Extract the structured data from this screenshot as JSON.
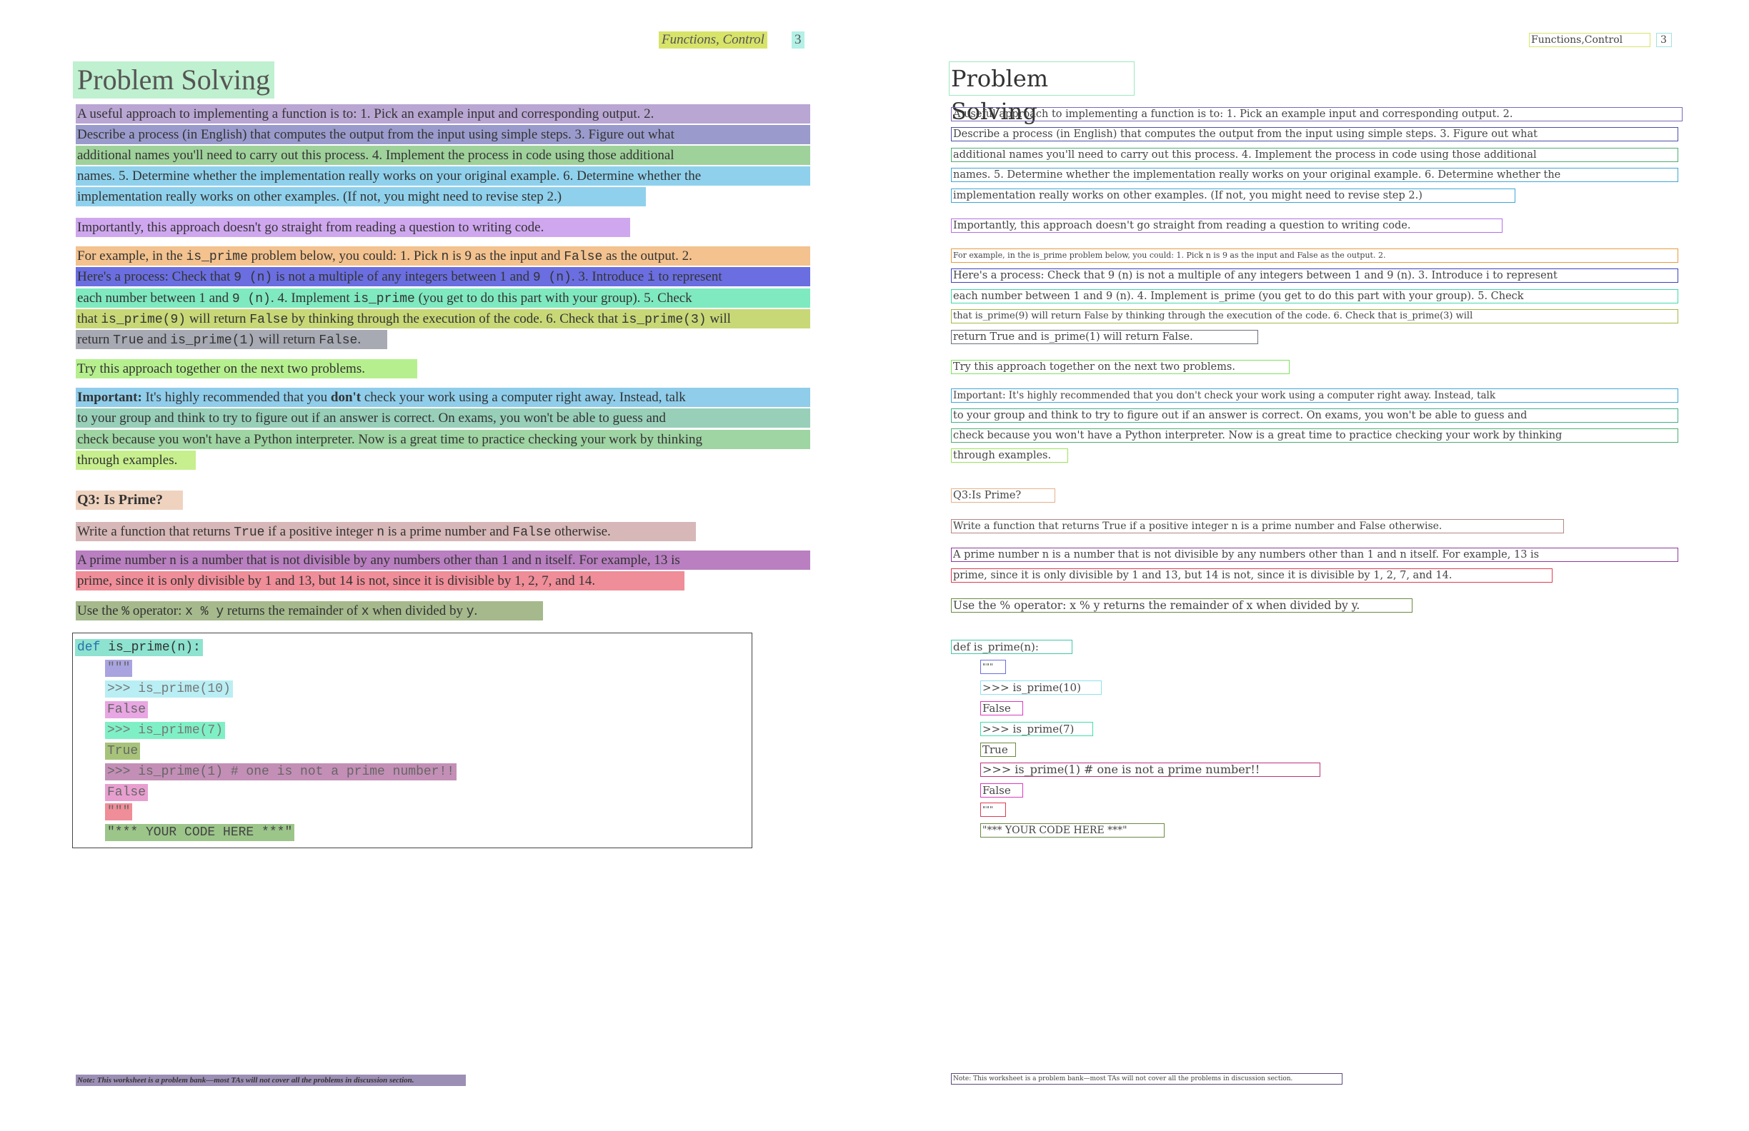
{
  "header": {
    "section": "Functions, Control",
    "page": "3",
    "right_section": "Functions,Control",
    "right_page": "3"
  },
  "title": "Problem Solving",
  "p1": [
    "A useful approach to implementing a function is to: 1. Pick an example input and corresponding output. 2.",
    "Describe a process (in English) that computes the output from the input using simple steps. 3. Figure out what",
    "additional names you'll need to carry out this process. 4. Implement the process in code using those additional",
    "names. 5. Determine whether the implementation really works on your original example. 6. Determine whether the",
    "implementation really works on other examples. (If not, you might need to revise step 2.)"
  ],
  "p1_right": [
    "A useful approach to implementing a function is to: 1. Pick an example input and corresponding output. 2.",
    "Describe a process (in English) that computes the output from the input using simple steps. 3. Figure out what",
    "additional names you'll need to carry out this process. 4. Implement the process in code using those additional",
    "names. 5. Determine whether the implementation really works on your original example. 6. Determine whether the",
    "implementation really works on other examples. (If not, you might need to revise step 2.)"
  ],
  "p2": "Importantly, this approach doesn't go straight from reading a question to writing code.",
  "p3": {
    "l1_a": "For example, in the ",
    "l1_code1": "is_prime",
    "l1_b": " problem below, you could: 1. Pick ",
    "l1_code2": "n",
    "l1_c": " is 9 as the input and ",
    "l1_code3": "False",
    "l1_d": " as the output. 2.",
    "l2_a": "Here's a process: Check that ",
    "l2_code1": "9 (n)",
    "l2_b": " is not a multiple of any integers between 1 and ",
    "l2_code2": "9 (n)",
    "l2_c": ". 3. Introduce ",
    "l2_code3": "i",
    "l2_d": " to represent",
    "l3_a": "each number between 1 and ",
    "l3_code1": "9 (n)",
    "l3_b": ". 4. Implement ",
    "l3_code2": "is_prime",
    "l3_c": " (you get to do this part with your group). 5. Check",
    "l4_a": "that ",
    "l4_code1": "is_prime(9)",
    "l4_b": " will return ",
    "l4_code2": "False",
    "l4_c": " by thinking through the execution of the code. 6. Check that ",
    "l4_code3": "is_prime(3)",
    "l4_d": " will",
    "l5_a": "return ",
    "l5_code1": "True",
    "l5_b": " and ",
    "l5_code2": "is_prime(1)",
    "l5_c": " will return ",
    "l5_code3": "False",
    "l5_d": ".",
    "right": [
      "For example, in the is_prime problem below, you could: 1. Pick n is 9 as the input and False as the output. 2.",
      "Here's a process: Check that 9 (n) is not a multiple of any integers between 1 and 9 (n). 3. Introduce i to represent",
      "each number between 1 and 9 (n). 4. Implement is_prime (you get to do this part with your group). 5. Check",
      "that is_prime(9) will return False by thinking through the execution of the code. 6. Check that is_prime(3) will",
      "return True and is_prime(1) will return False."
    ]
  },
  "p4": "Try this approach together on the next two problems.",
  "p5": {
    "l1_bold": "Important:",
    "l1_a": " It's highly recommended that you ",
    "l1_bold2": "don't",
    "l1_b": " check your work using a computer right away. Instead, talk",
    "l2": "to your group and think to try to figure out if an answer is correct. On exams, you won't be able to guess and",
    "l3": "check because you won't have a Python interpreter. Now is a great time to practice checking your work by thinking",
    "l4": "through examples.",
    "right": [
      "Important: It's highly recommended that you don't check your work using a computer right away. Instead, talk",
      "to your group and think to try to figure out if an answer is correct. On exams, you won't be able to guess and",
      "check because you won't have a Python interpreter. Now is a great time to practice checking your work by thinking",
      "through examples."
    ]
  },
  "q3": {
    "heading": "Q3: Is Prime?",
    "heading_right": "Q3:Is Prime?",
    "l1_a": "Write a function that returns ",
    "l1_code1": "True",
    "l1_b": " if a positive integer ",
    "l1_code2": "n",
    "l1_c": " is a prime number and ",
    "l1_code3": "False",
    "l1_d": " otherwise.",
    "l1_right": "Write a function that returns True if a positive integer n is a prime number and False otherwise.",
    "l2": "A prime number n is a number that is not divisible by any numbers other than 1 and n itself. For example, 13 is",
    "l3": "prime, since it is only divisible by 1 and 13, but 14 is not, since it is divisible by 1, 2, 7, and 14.",
    "l2_right": "A prime number n is a number that is not divisible by any numbers other than 1 and n itself. For example, 13 is",
    "l3_right": "prime, since it is only divisible by 1 and 13, but 14 is not, since it is divisible by 1, 2, 7, and 14.",
    "l4_a": "Use the ",
    "l4_code1": "%",
    "l4_b": " operator: ",
    "l4_code2": "x % y",
    "l4_c": " returns the remainder of ",
    "l4_code3": "x",
    "l4_d": " when divided by ",
    "l4_code4": "y",
    "l4_e": ".",
    "l4_right": "Use the % operator: x % y returns the remainder of x when divided by y."
  },
  "code": {
    "def_kw": "def",
    "def_rest": " is_prime(n):",
    "def_right": "def is_prime(n):",
    "doc_open": "\"\"\"",
    "doc_open_right": "\"\"\"",
    "ex1": ">>> is_prime(10)",
    "out1": "False",
    "ex2": ">>> is_prime(7)",
    "out2": "True",
    "ex3": ">>> is_prime(1) # one is not a prime number!!",
    "out3": "False",
    "doc_close": "\"\"\"",
    "doc_close_right": "\"\"\"",
    "placeholder": "\"*** YOUR CODE HERE ***\""
  },
  "footnote": "Note: This worksheet is a problem bank—most TAs will not cover all the problems in discussion section.",
  "colors": {
    "title": "#bff0cf",
    "header_section": "#d8e36a",
    "header_page": "#b3f0e6",
    "p1": [
      "#b9a6d3",
      "#9a9bcc",
      "#9fd19b",
      "#8fd1ec",
      "#8fd1ec"
    ],
    "p2": "#cfa7ef",
    "p3": [
      "#f3c28e",
      "#6a6ee0",
      "#7fe9c0",
      "#c8d877",
      "#a7aab3"
    ],
    "p4": "#b6f08e",
    "p5": [
      "#8fcdea",
      "#98cfb9",
      "#9fd4a3",
      "#c7ef8e"
    ],
    "q3_heading": "#efd3bf",
    "q3_l1": "#d7b7b7",
    "q3_l2": "#b97fc0",
    "q3_l3": "#ef8d98",
    "q3_l4": "#a5b98c"
  }
}
